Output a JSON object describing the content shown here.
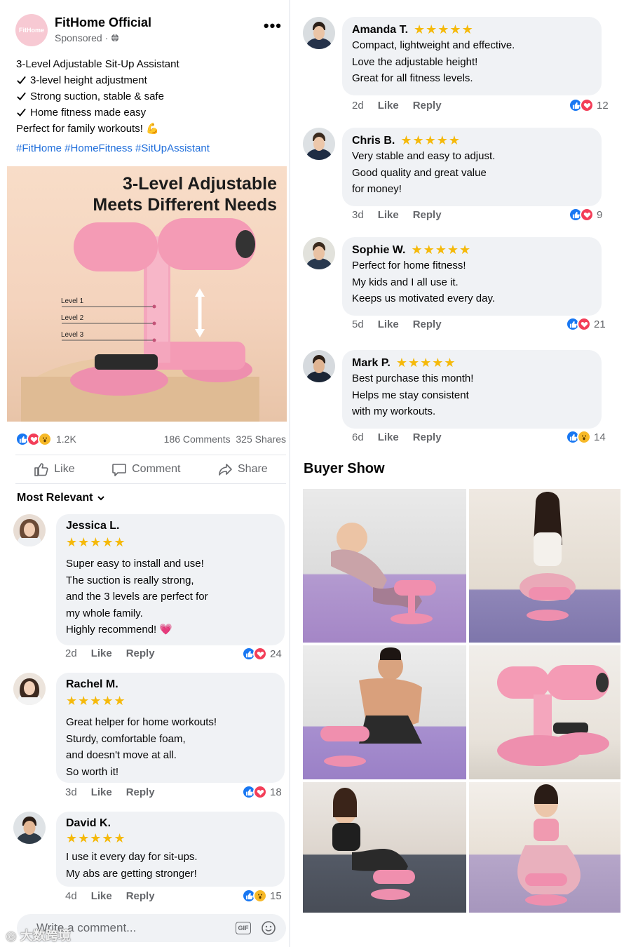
{
  "post": {
    "page_name": "FitHome Official",
    "sponsored": "Sponsored ·",
    "avatar_text": "FitHome",
    "caption_title": "3-Level Adjustable Sit-Up Assistant",
    "features": [
      "3-level height adjustment",
      "Strong suction, stable & safe",
      "Home fitness made easy"
    ],
    "tagline": "Perfect for family workouts! 💪",
    "hashtags": "#FitHome #HomeFitness #SitUpAssistant",
    "product_title_1": "3-Level Adjustable",
    "product_title_2": "Meets Different Needs",
    "levels": [
      "Level 1",
      "Level 2",
      "Level 3"
    ],
    "reactions_count": "1.2K",
    "comments_shares": "186 Comments  325 Shares",
    "actions": {
      "like": "Like",
      "comment": "Comment",
      "share": "Share"
    },
    "sort_label": "Most Relevant",
    "write_placeholder": "Write a comment...",
    "gif_label": "GIF",
    "watermark": "大数跨境"
  },
  "comments_left": [
    {
      "name": "Jessica L.",
      "stars": "★★★★★",
      "lines": [
        "Super easy to install and use!",
        "The suction is really strong,",
        "and the 3 levels are perfect for",
        "my whole family.",
        "Highly recommend! 💗"
      ],
      "time": "2d",
      "like": "Like",
      "reply": "Reply",
      "reactions": "24",
      "react_types": [
        "like",
        "love"
      ]
    },
    {
      "name": "Rachel M.",
      "stars": "★★★★★",
      "lines": [
        "Great helper for home workouts!",
        "Sturdy, comfortable foam,",
        "and doesn't move at all.",
        "So worth it!"
      ],
      "time": "3d",
      "like": "Like",
      "reply": "Reply",
      "reactions": "18",
      "react_types": [
        "like",
        "love"
      ]
    },
    {
      "name": "David K.",
      "stars": "★★★★★",
      "lines": [
        "I use it every day for sit-ups.",
        "My abs are getting stronger!"
      ],
      "time": "4d",
      "like": "Like",
      "reply": "Reply",
      "reactions": "15",
      "react_types": [
        "like",
        "wow"
      ]
    }
  ],
  "comments_right": [
    {
      "name": "Amanda T.",
      "stars": "★★★★★",
      "lines": [
        "Compact, lightweight and effective.",
        "Love the adjustable height!",
        "Great for all fitness levels."
      ],
      "time": "2d",
      "like": "Like",
      "reply": "Reply",
      "reactions": "12",
      "react_types": [
        "like",
        "love"
      ]
    },
    {
      "name": "Chris B.",
      "stars": "★★★★★",
      "lines": [
        "Very stable and easy to adjust.",
        "Good quality and great value",
        "for money!"
      ],
      "time": "3d",
      "like": "Like",
      "reply": "Reply",
      "reactions": "9",
      "react_types": [
        "like",
        "love"
      ]
    },
    {
      "name": "Sophie W.",
      "stars": "★★★★★",
      "lines": [
        "Perfect for home fitness!",
        "My kids and I all use it.",
        "Keeps us motivated every day."
      ],
      "time": "5d",
      "like": "Like",
      "reply": "Reply",
      "reactions": "21",
      "react_types": [
        "like",
        "love"
      ]
    },
    {
      "name": "Mark P.",
      "stars": "★★★★★",
      "lines": [
        "Best purchase this month!",
        "Helps me stay consistent",
        "with my workouts."
      ],
      "time": "6d",
      "like": "Like",
      "reply": "Reply",
      "reactions": "14",
      "react_types": [
        "like",
        "wow"
      ]
    }
  ],
  "buyer_show": {
    "title": "Buyer Show"
  },
  "colors": {
    "brand_blue": "#1877f2",
    "hashtag": "#216fdb",
    "love": "#f33e58",
    "star": "#f5b90a",
    "bubble": "#f0f2f5",
    "product_pink": "#f49bb5"
  }
}
